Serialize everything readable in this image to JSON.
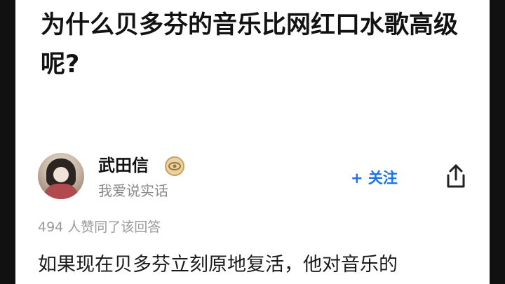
{
  "question": {
    "title": "为什么贝多芬的音乐比网红口水歌高级呢?"
  },
  "answer": {
    "author_name": "武田信",
    "author_bio": "我爱说实话",
    "follow_label": "+ 关注",
    "vote_text": "494 人赞同了该回答",
    "text_preview": "如果现在贝多芬立刻原地复活，他对音乐的"
  },
  "icons": {
    "badge": "badge-icon",
    "share": "share-icon",
    "avatar": "avatar"
  },
  "colors": {
    "accent": "#1d72e8",
    "badge_gold": "#c9a15a"
  }
}
